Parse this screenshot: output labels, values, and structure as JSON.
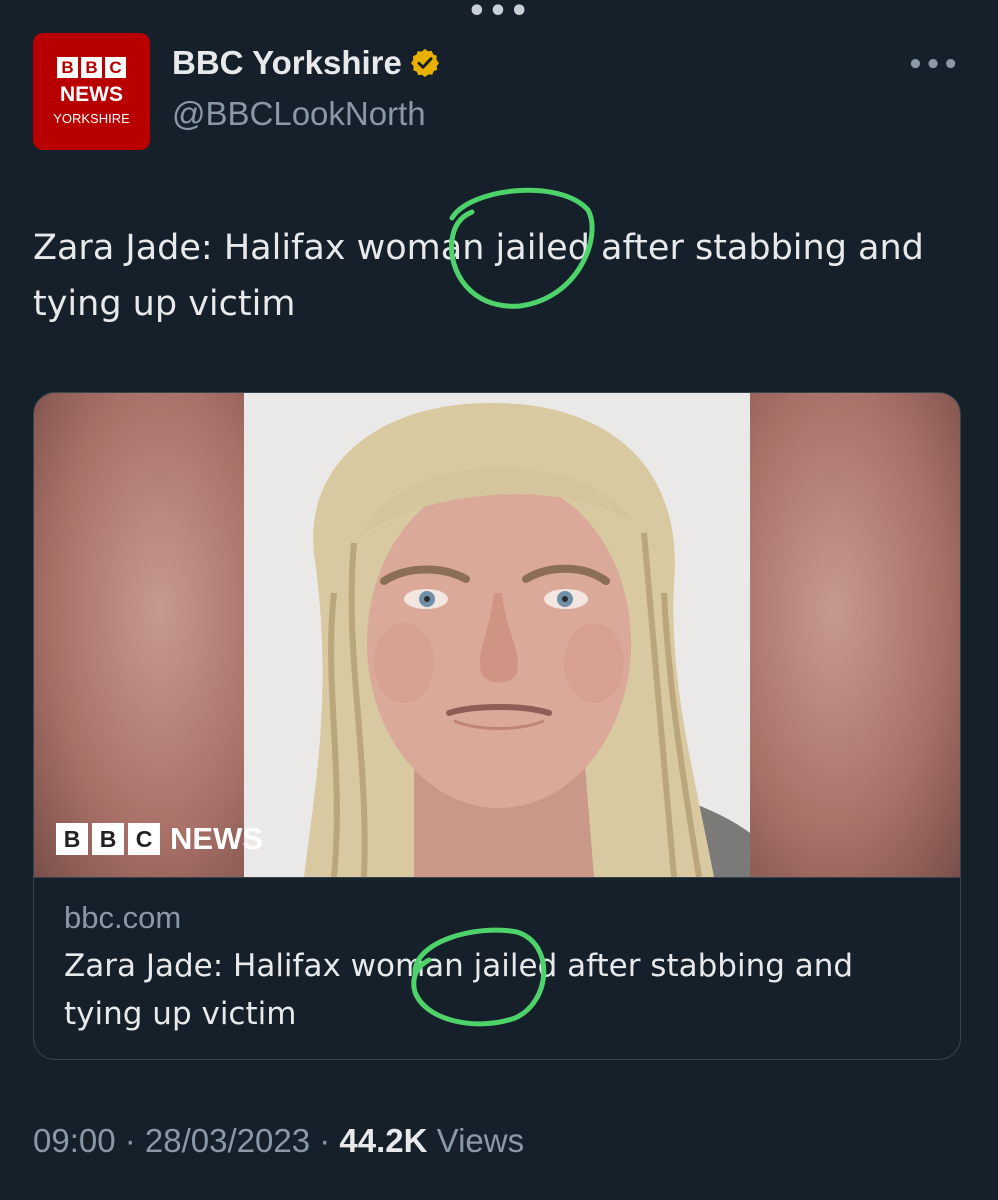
{
  "app": {
    "top_menu": "•••"
  },
  "author": {
    "display_name": "BBC Yorkshire",
    "handle": "@BBCLookNorth",
    "avatar": {
      "blocks": [
        "B",
        "B",
        "C"
      ],
      "line1": "NEWS",
      "line2": "YORKSHIRE",
      "color": "#b80000"
    },
    "verified_badge_color": "#e8b100"
  },
  "tweet": {
    "text": "Zara Jade: Halifax woman jailed after stabbing and tying up victim",
    "more_menu": "•••"
  },
  "card": {
    "image": {
      "watermark_blocks": [
        "B",
        "B",
        "C"
      ],
      "watermark_text": "NEWS"
    },
    "domain": "bbc.com",
    "title": "Zara Jade: Halifax woman jailed after stabbing and tying up victim"
  },
  "annotation": {
    "circle_color": "#4ed36b"
  },
  "footer": {
    "time": "09:00",
    "sep1": " · ",
    "date": "28/03/2023",
    "sep2": " · ",
    "views_count": "44.2K",
    "views_label": " Views"
  }
}
